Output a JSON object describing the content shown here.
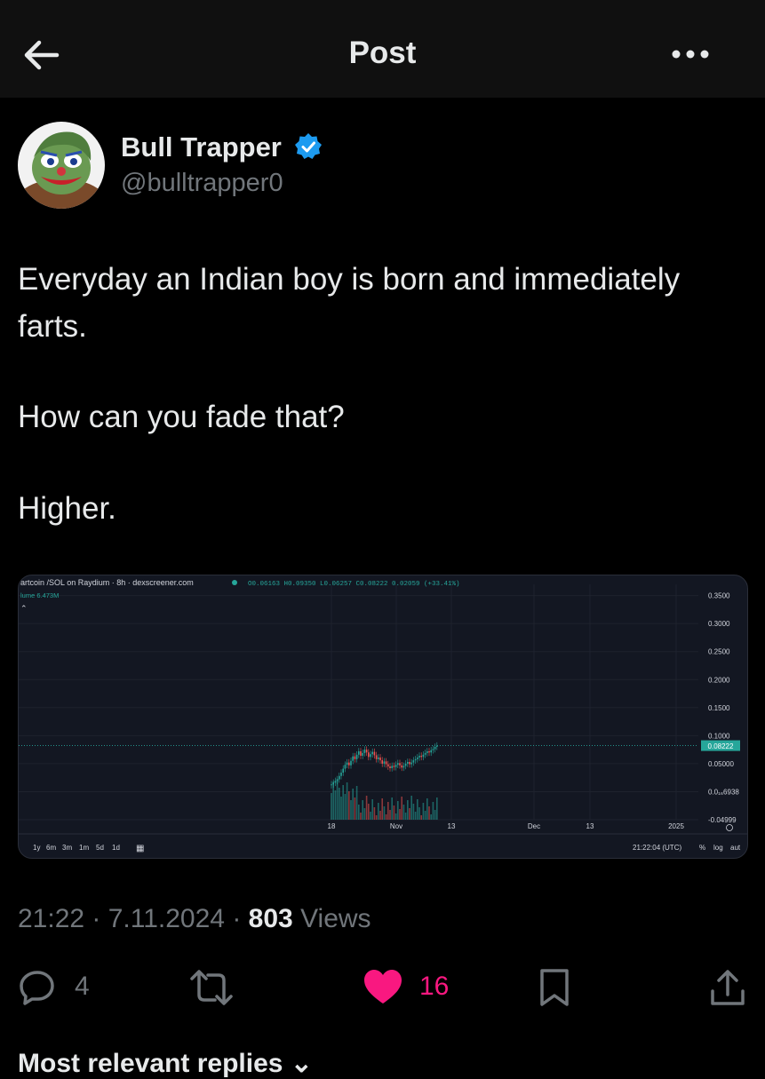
{
  "header": {
    "title": "Post"
  },
  "author": {
    "display_name": "Bull Trapper",
    "handle": "@bulltrapper0"
  },
  "tweet": {
    "lines": [
      "Everyday an Indian boy is born and immediately",
      "farts.",
      "How can you fade that?",
      "Higher."
    ]
  },
  "chart_data": {
    "type": "candlestick",
    "title": "artcoin /SOL on Raydium · 8h · dexscreener.com",
    "ohlc_label": "O0.06163 H0.09350 L0.06257 C0.08222 0.02059 (+33.41%)",
    "volume_label": "lume 6.473M",
    "y_ticks": [
      "0.3500",
      "0.3000",
      "0.2500",
      "0.2000",
      "0.1500",
      "0.1000",
      "0.05000",
      "0.0₁₆6938",
      "-0.04999"
    ],
    "y_ticks_values": [
      0.35,
      0.3,
      0.25,
      0.2,
      0.15,
      0.1,
      0.05,
      0.0,
      -0.04999
    ],
    "x_ticks": [
      "18",
      "Nov",
      "13",
      "Dec",
      "13",
      "2025"
    ],
    "last_price": "0.08222",
    "ylim": [
      -0.05,
      0.37
    ],
    "close_series": [
      0.013,
      0.016,
      0.019,
      0.022,
      0.028,
      0.034,
      0.041,
      0.048,
      0.052,
      0.047,
      0.055,
      0.063,
      0.058,
      0.066,
      0.072,
      0.064,
      0.069,
      0.075,
      0.07,
      0.062,
      0.067,
      0.071,
      0.065,
      0.058,
      0.061,
      0.056,
      0.05,
      0.054,
      0.049,
      0.045,
      0.042,
      0.046,
      0.044,
      0.048,
      0.051,
      0.047,
      0.043,
      0.046,
      0.05,
      0.053,
      0.049,
      0.052,
      0.056,
      0.058,
      0.061,
      0.064,
      0.062,
      0.066,
      0.069,
      0.072,
      0.07,
      0.074,
      0.076,
      0.08,
      0.082
    ]
  },
  "chart_ui": {
    "ranges": [
      "1y",
      "6m",
      "3m",
      "1m",
      "5d",
      "1d"
    ],
    "time": "21:22:04 (UTC)",
    "scale_opts": [
      "%",
      "log",
      "aut"
    ]
  },
  "meta": {
    "time": "21:22",
    "date": "7.11.2024",
    "views_count": "803",
    "views_label": "Views"
  },
  "actions": {
    "replies": "4",
    "likes": "16"
  },
  "replies_heading": "Most relevant replies",
  "colors": {
    "like": "#f91880",
    "up": "#26a69a",
    "down": "#ef5350",
    "verified": "#1d9bf0"
  }
}
